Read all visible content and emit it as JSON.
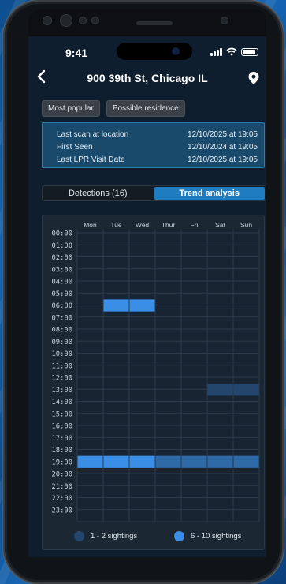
{
  "status_bar": {
    "time": "9:41"
  },
  "header": {
    "title": "900 39th St, Chicago IL",
    "back_icon": "chevron-left-icon",
    "location_icon": "location-pin-icon"
  },
  "tags": [
    "Most popular",
    "Possible residence"
  ],
  "info": [
    {
      "label": "Last scan at location",
      "value": "12/10/2025 at 19:05"
    },
    {
      "label": "First Seen",
      "value": "12/10/2024 at 19:05"
    },
    {
      "label": "Last LPR Visit Date",
      "value": "12/10/2025 at 19:05"
    }
  ],
  "tabs": [
    {
      "label": "Detections (16)",
      "active": false
    },
    {
      "label": "Trend analysis",
      "active": true
    }
  ],
  "colors": {
    "accent": "#1f7cc1",
    "level_low": "#25466c",
    "level_mid": "#2f6aa6",
    "level_high": "#3a8ee6"
  },
  "chart_data": {
    "type": "heatmap",
    "columns": [
      "Mon",
      "Tue",
      "Wed",
      "Thur",
      "Fri",
      "Sat",
      "Sun"
    ],
    "rows": [
      "00:00",
      "01:00",
      "02:00",
      "03:00",
      "04:00",
      "05:00",
      "06:00",
      "07:00",
      "08:00",
      "09:00",
      "10:00",
      "11:00",
      "12:00",
      "13:00",
      "14:00",
      "15:00",
      "16:00",
      "17:00",
      "18:00",
      "19:00",
      "20:00",
      "21:00",
      "22:00",
      "23:00"
    ],
    "cells": [
      {
        "day": "Tue",
        "hour": "06:00",
        "level": "high"
      },
      {
        "day": "Wed",
        "hour": "06:00",
        "level": "high"
      },
      {
        "day": "Sat",
        "hour": "13:00",
        "level": "low"
      },
      {
        "day": "Sun",
        "hour": "13:00",
        "level": "low"
      },
      {
        "day": "Mon",
        "hour": "19:00",
        "level": "high"
      },
      {
        "day": "Tue",
        "hour": "19:00",
        "level": "high"
      },
      {
        "day": "Wed",
        "hour": "19:00",
        "level": "high"
      },
      {
        "day": "Thur",
        "hour": "19:00",
        "level": "mid"
      },
      {
        "day": "Fri",
        "hour": "19:00",
        "level": "mid"
      },
      {
        "day": "Sat",
        "hour": "19:00",
        "level": "mid"
      },
      {
        "day": "Sun",
        "hour": "19:00",
        "level": "mid"
      }
    ],
    "grid": true
  },
  "legend": [
    {
      "label": "1 - 2 sightings",
      "color": "#25466c"
    },
    {
      "label": "6 - 10 sightings",
      "color": "#3a8ee6"
    }
  ]
}
